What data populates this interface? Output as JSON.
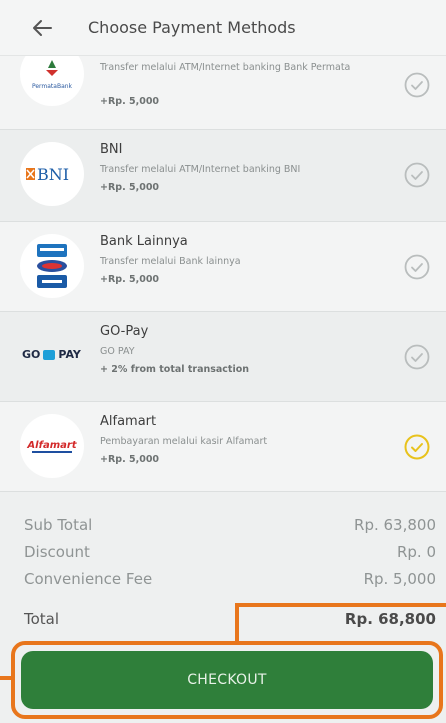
{
  "header": {
    "title": "Choose Payment Methods"
  },
  "methods": [
    {
      "name": "",
      "description": "Transfer melalui ATM/Internet banking Bank Permata",
      "fee": "+Rp. 5,000",
      "logo_text": "PermataBank",
      "selected": false
    },
    {
      "name": "BNI",
      "description": "Transfer melalui ATM/Internet banking BNI",
      "fee": "+Rp. 5,000",
      "logo_text": "BNI",
      "selected": false
    },
    {
      "name": "Bank Lainnya",
      "description": "Transfer melalui Bank lainnya",
      "fee": "+Rp. 5,000",
      "logo_text": "",
      "selected": false
    },
    {
      "name": "GO-Pay",
      "description": "GO PAY",
      "fee": "+ 2% from total transaction",
      "logo_text_a": "GO",
      "logo_text_b": "PAY",
      "selected": false
    },
    {
      "name": "Alfamart",
      "description": "Pembayaran melalui kasir Alfamart",
      "fee": "+Rp. 5,000",
      "logo_text": "Alfamart",
      "selected": true
    }
  ],
  "summary": {
    "subtotal_label": "Sub Total",
    "subtotal_value": "Rp. 63,800",
    "discount_label": "Discount",
    "discount_value": "Rp. 0",
    "fee_label": "Convenience Fee",
    "fee_value": "Rp. 5,000",
    "total_label": "Total",
    "total_value": "Rp. 68,800"
  },
  "checkout_label": "CHECKOUT",
  "colors": {
    "primary": "#2f7f3a",
    "highlight": "#e8761c",
    "selected_check": "#e8c21c",
    "check": "#b9bdbd"
  },
  "icons": [
    "back-arrow-icon",
    "check-circle-icon"
  ]
}
